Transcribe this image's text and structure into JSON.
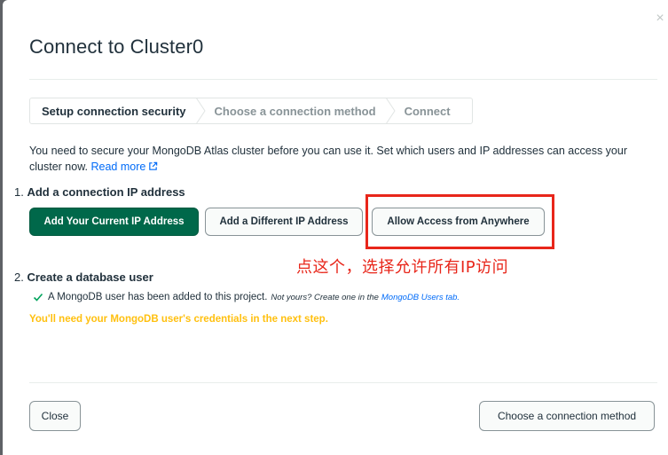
{
  "modal": {
    "title": "Connect to Cluster0",
    "close_glyph": "×"
  },
  "stepper": {
    "steps": [
      {
        "label": "Setup connection security",
        "state": "active"
      },
      {
        "label": "Choose a connection method",
        "state": "inactive"
      },
      {
        "label": "Connect",
        "state": "inactive"
      }
    ]
  },
  "description": {
    "text": "You need to secure your MongoDB Atlas cluster before you can use it. Set which users and IP addresses can access your cluster now.",
    "read_more": "Read more"
  },
  "section1": {
    "number": "1.",
    "title": "Add a connection IP address",
    "buttons": {
      "add_current": "Add Your Current IP Address",
      "add_different": "Add a Different IP Address",
      "allow_anywhere": "Allow Access from Anywhere"
    }
  },
  "annotation": {
    "text": "点这个，选择允许所有IP访问",
    "color": "#e8261a"
  },
  "section2": {
    "number": "2.",
    "title": "Create a database user",
    "status_text": "A MongoDB user has been added to this project.",
    "note": "Not yours? Create one in the",
    "note_link": "MongoDB Users tab.",
    "warning": "You'll need your MongoDB user's credentials in the next step."
  },
  "footer": {
    "close_label": "Close",
    "next_label": "Choose a connection method"
  },
  "colors": {
    "primary": "#00684a",
    "link": "#016bf8",
    "warning": "#ffc010",
    "highlight": "#e8261a"
  },
  "icons": {
    "close": "close-icon",
    "external_link": "external-link-icon",
    "check": "check-icon",
    "chevron": "chevron-right-icon"
  }
}
